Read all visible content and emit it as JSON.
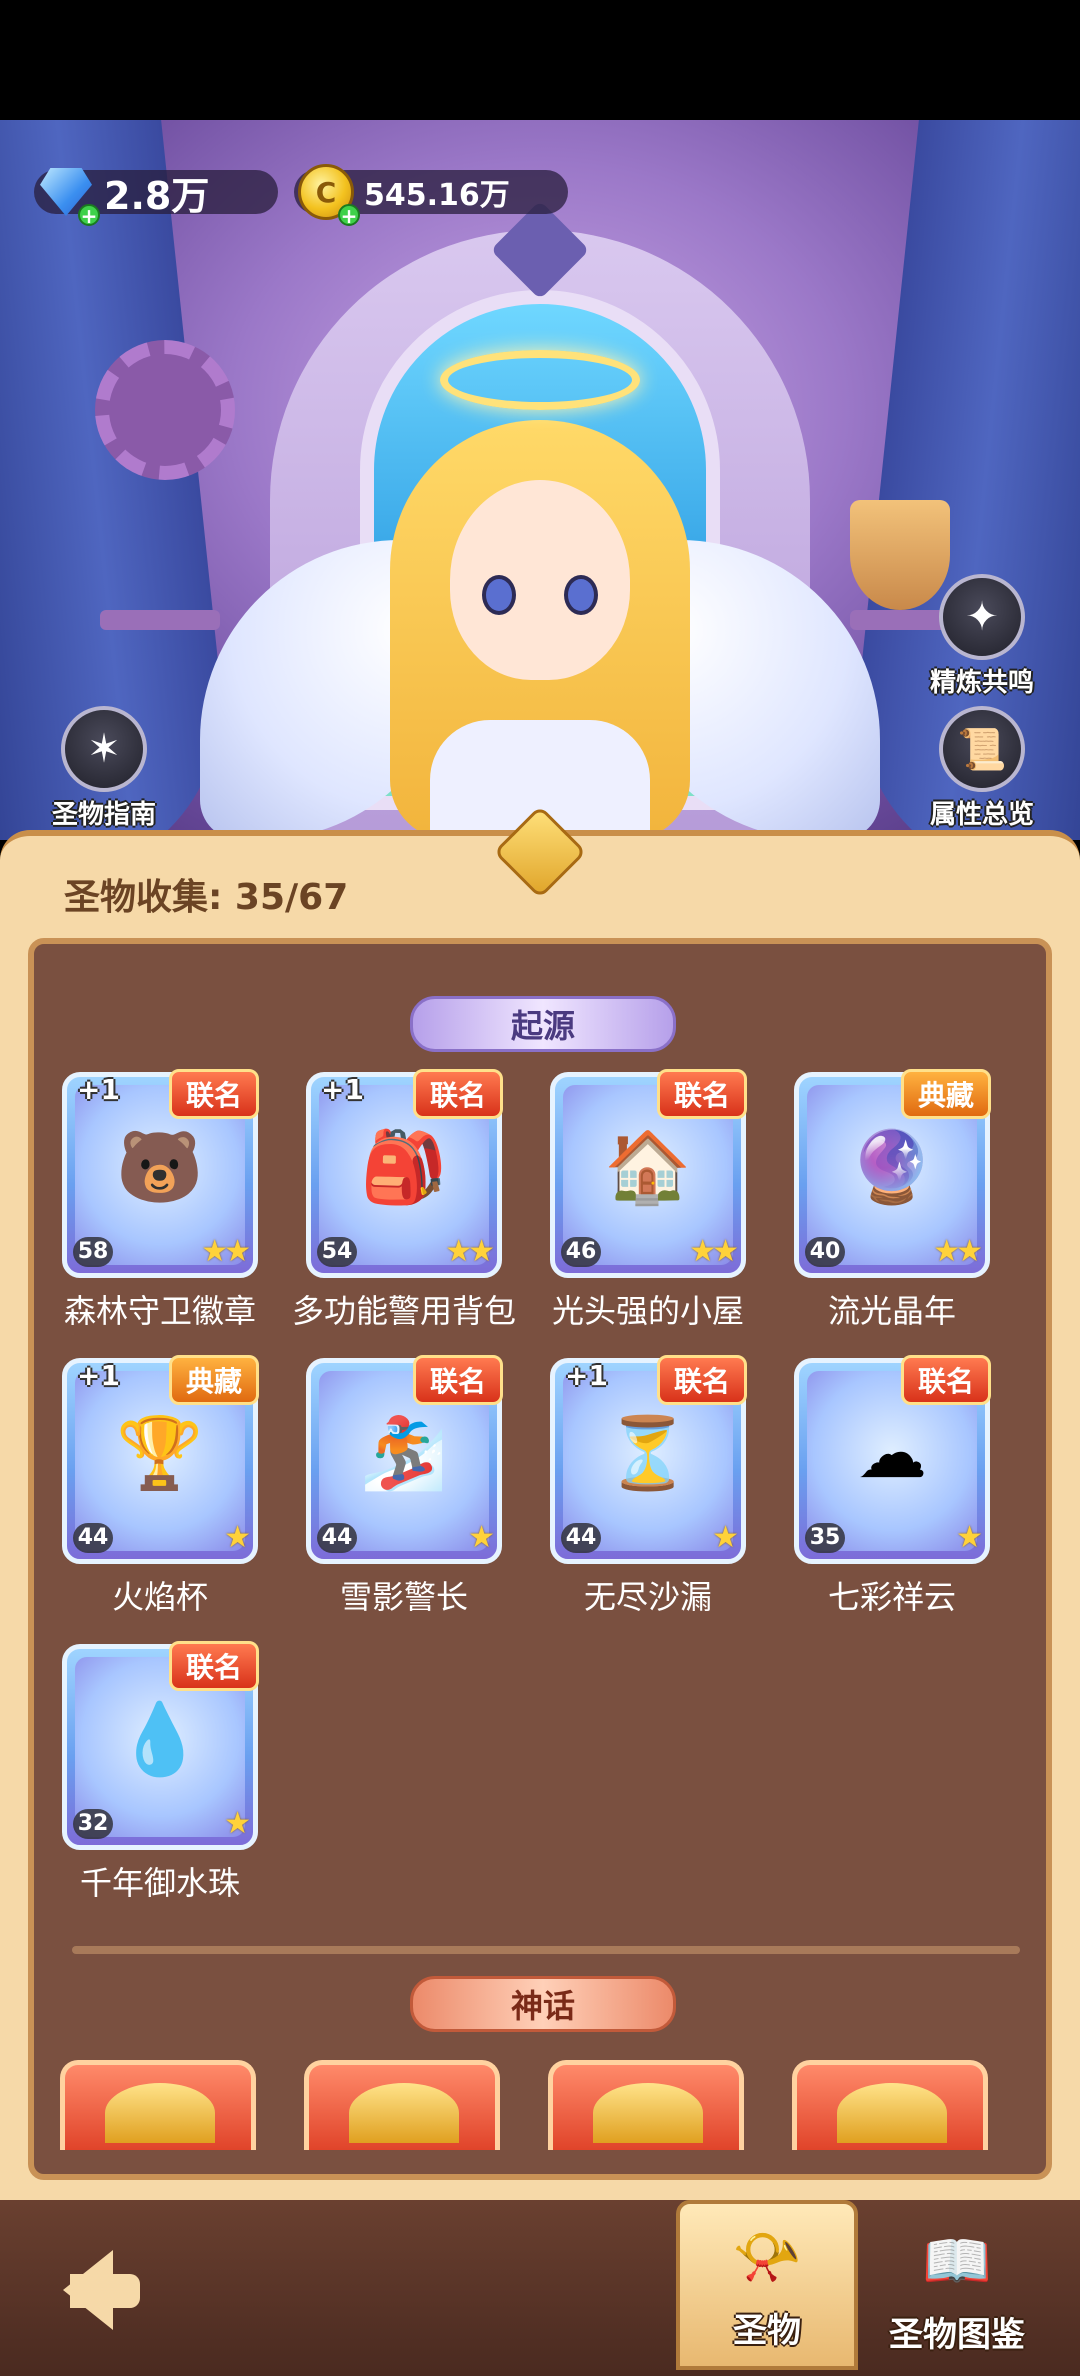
{
  "currency": {
    "gems": "2.8万",
    "coins": "545.16万",
    "coin_glyph": "C"
  },
  "side_buttons": {
    "relic_guide": "圣物指南",
    "refine_resonance": "精炼共鸣",
    "attribute_overview": "属性总览"
  },
  "collection": {
    "label": "圣物收集: 35/67"
  },
  "sections": {
    "origin": "起源",
    "myth": "神话"
  },
  "items": [
    {
      "name": "森林守卫徽章",
      "badge": "联名",
      "plus": "+1",
      "level": "58",
      "stars": "★★",
      "icon": "bear-badge-icon"
    },
    {
      "name": "多功能警用背包",
      "badge": "联名",
      "plus": "+1",
      "level": "54",
      "stars": "★★",
      "icon": "police-backpack-icon"
    },
    {
      "name": "光头强的小屋",
      "badge": "联名",
      "plus": "",
      "level": "46",
      "stars": "★★",
      "icon": "cabin-icon"
    },
    {
      "name": "流光晶年",
      "badge": "典藏",
      "plus": "",
      "level": "40",
      "stars": "★★",
      "icon": "crystal-ball-icon"
    },
    {
      "name": "火焰杯",
      "badge": "典藏",
      "plus": "+1",
      "level": "44",
      "stars": "★",
      "icon": "trophy-icon"
    },
    {
      "name": "雪影警长",
      "badge": "联名",
      "plus": "",
      "level": "44",
      "stars": "★",
      "icon": "snowboard-sheriff-icon"
    },
    {
      "name": "无尽沙漏",
      "badge": "联名",
      "plus": "+1",
      "level": "44",
      "stars": "★",
      "icon": "hourglass-icon"
    },
    {
      "name": "七彩祥云",
      "badge": "联名",
      "plus": "",
      "level": "35",
      "stars": "★",
      "icon": "rainbow-cloud-icon"
    },
    {
      "name": "千年御水珠",
      "badge": "联名",
      "plus": "",
      "level": "32",
      "stars": "★",
      "icon": "water-orb-icon"
    }
  ],
  "bottom_nav": {
    "relics": "圣物",
    "relic_codex": "圣物图鉴"
  },
  "colors": {
    "panel": "#7a5040",
    "frame": "#f6d9a8",
    "badge_collab": "#d8321a",
    "badge_collection": "#e06a10"
  }
}
